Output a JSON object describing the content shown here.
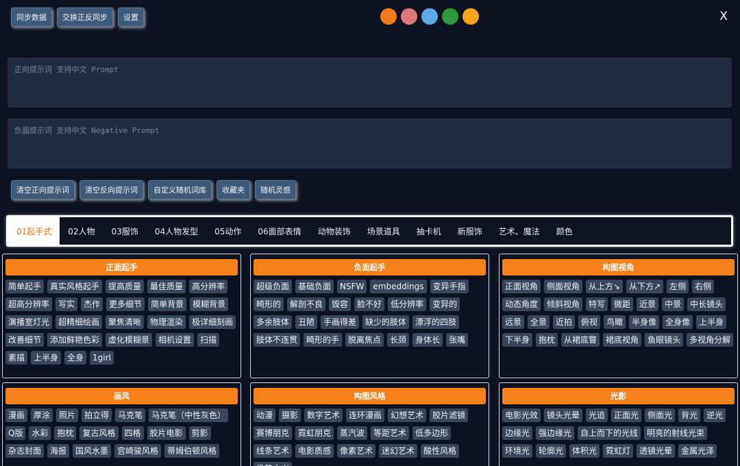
{
  "toolbar": {
    "buttons": [
      "同步数据",
      "交换正反同步",
      "设置"
    ]
  },
  "color_dots": [
    "#f27c1c",
    "#e0777d",
    "#5aaae7",
    "#2e9a3e",
    "#f7a31e"
  ],
  "close_label": "X",
  "prompts": {
    "positive_placeholder": "正向提示词 支持中文 Prompt",
    "negative_placeholder": "负面提示词 支持中文 Negative Prompt"
  },
  "actions": [
    "清空正向提示词",
    "清空反向提示词",
    "自定义随机词库",
    "收藏夹",
    "随机灵感"
  ],
  "tabs": [
    "01起手式",
    "02人物",
    "03服饰",
    "04人物发型",
    "05动作",
    "06面部表情",
    "动物装饰",
    "场景道具",
    "抽卡机",
    "新服饰",
    "艺术、魔法",
    "颜色"
  ],
  "active_tab": "01起手式",
  "panels": [
    {
      "title": "正面起手",
      "tags": [
        "简单起手",
        "真实风格起手",
        "提高质量",
        "最佳质量",
        "高分辨率",
        "超高分辨率",
        "写实",
        "杰作",
        "更多细节",
        "简单背景",
        "模糊背景",
        "演播室灯光",
        "超精细绘画",
        "聚焦清晰",
        "物理渲染",
        "极详细刻画",
        "改善细节",
        "添加鲜艳色彩",
        "虚化模糊景",
        "相机设置",
        "扫描",
        "素描",
        "上半身",
        "全身",
        "1girl"
      ]
    },
    {
      "title": "负面起手",
      "tags": [
        "超级负面",
        "基础负面",
        "NSFW",
        "embeddings",
        "变异手指",
        "畸形的",
        "解剖不良",
        "毁容",
        "脸不好",
        "低分辨率",
        "变异的",
        "多余肢体",
        "丑陋",
        "手画得差",
        "缺少的肢体",
        "漂浮的四肢",
        "肢体不连贯",
        "畸形的手",
        "脱离焦点",
        "长颈",
        "身体长",
        "张嘴"
      ]
    },
    {
      "title": "构图视角",
      "tags": [
        "正面视角",
        "侧面视角",
        "从上方↘",
        "从下方↗",
        "左侧",
        "右侧",
        "动态角度",
        "倾斜视角",
        "特写",
        "微距",
        "近景",
        "中景",
        "中长镜头",
        "远景",
        "全景",
        "近拍",
        "俯视",
        "鸟瞰",
        "半身像",
        "全身像",
        "上半身",
        "下半身",
        "抱枕",
        "从裙底瞥",
        "裙底视角",
        "鱼眼镜头",
        "多视角分解"
      ]
    },
    {
      "title": "画风",
      "tags": [
        "漫画",
        "厚涂",
        "照片",
        "拍立得",
        "马克笔",
        "马克笔（中性灰色）",
        "Q版",
        "水彩",
        "抱枕",
        "复古风格",
        "四格",
        "胶片电影",
        "剪影",
        "杂志封面",
        "海报",
        "国风水墨",
        "宫崎骏风格",
        "蒂姆伯顿风格"
      ]
    },
    {
      "title": "构图风格",
      "tags": [
        "动漫",
        "摄影",
        "数字艺术",
        "连环漫画",
        "幻想艺术",
        "胶片滤镜",
        "赛博朋克",
        "霓虹朋克",
        "蒸汽波",
        "等距艺术",
        "低多边形",
        "线条艺术",
        "电影质感",
        "像素艺术",
        "迷幻艺术",
        "酸性风格",
        "极简主义"
      ]
    },
    {
      "title": "光影",
      "tags": [
        "电影光效",
        "镜头光晕",
        "光追",
        "正面光",
        "侧面光",
        "背光",
        "逆光",
        "边缘光",
        "强边缘光",
        "自上而下的光线",
        "明亮的射线光束",
        "环境光",
        "轮廓光",
        "体积光",
        "霓虹灯",
        "透镜光晕",
        "金属光泽"
      ]
    }
  ]
}
